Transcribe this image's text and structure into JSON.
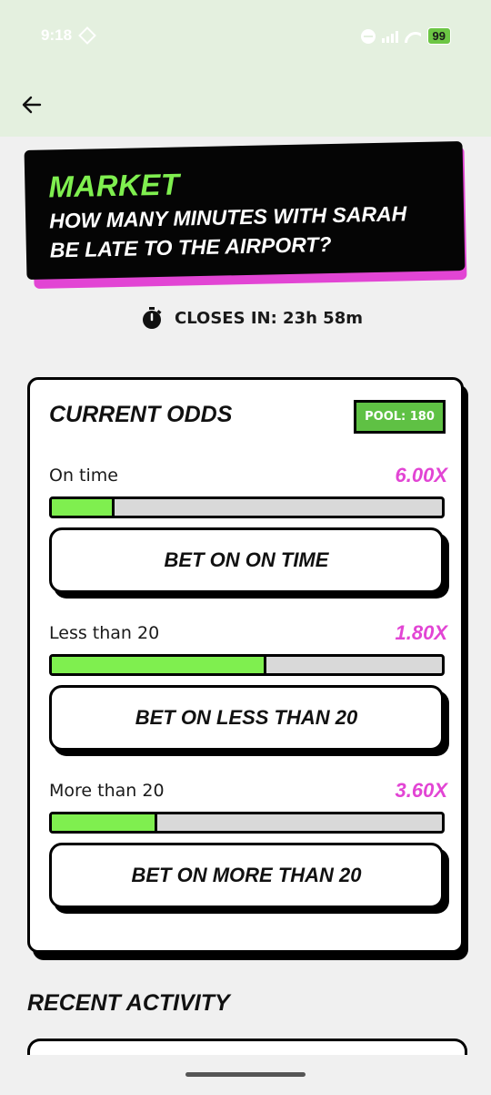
{
  "status_bar": {
    "time": "9:18",
    "battery": "99",
    "icons": [
      "app-diamond-icon",
      "dnd-icon",
      "signal-icon",
      "wifi-icon",
      "battery-icon"
    ]
  },
  "header": {
    "back_icon": "arrow-left-icon"
  },
  "market": {
    "label": "MARKET",
    "question": "HOW MANY MINUTES WITH SARAH BE LATE TO THE AIRPORT?"
  },
  "closes": {
    "icon": "stopwatch-icon",
    "text": "CLOSES IN: 23h 58m"
  },
  "odds": {
    "title": "CURRENT ODDS",
    "pool": "POOL: 180",
    "options": [
      {
        "label": "On time",
        "multiplier": "6.00X",
        "share": 0.16,
        "button": "BET ON ON TIME"
      },
      {
        "label": "Less than 20",
        "multiplier": "1.80X",
        "share": 0.55,
        "button": "BET ON LESS THAN 20"
      },
      {
        "label": "More than 20",
        "multiplier": "3.60X",
        "share": 0.27,
        "button": "BET ON MORE THAN 20"
      }
    ]
  },
  "recent": {
    "title": "RECENT ACTIVITY"
  },
  "colors": {
    "accent_green": "#7fef4f",
    "accent_pink": "#e245d4",
    "header_bg": "#e4f0df",
    "pool_green": "#5fc144"
  }
}
